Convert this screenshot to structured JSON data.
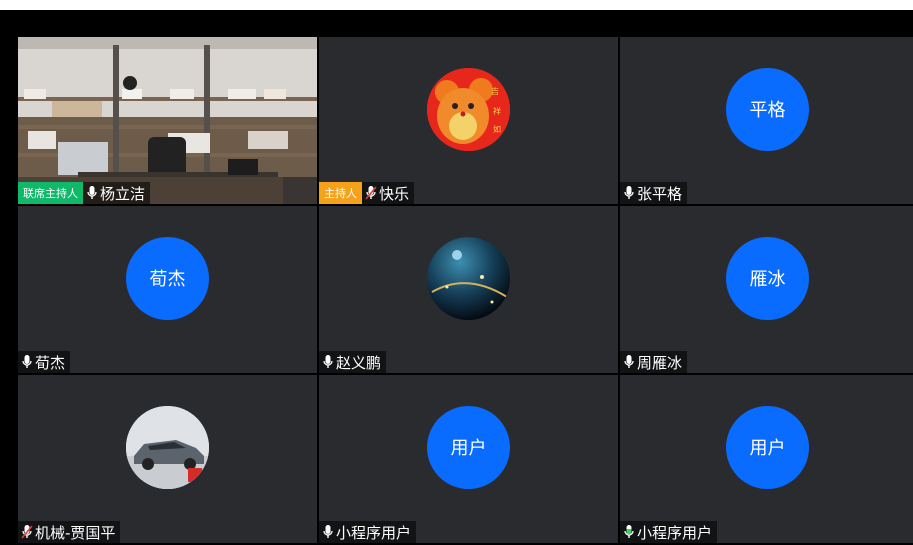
{
  "tiles": [
    {
      "key": "t1",
      "avatar_text": "",
      "avatar_kind": "office-video",
      "badge": "联席主持人",
      "badge_color": "#10b86a",
      "mic": "on",
      "name": "杨立洁"
    },
    {
      "key": "t2",
      "avatar_text": "",
      "avatar_kind": "cartoon-mouse-image",
      "badge": "主持人",
      "badge_color": "#f5a21a",
      "mic": "muted",
      "name": "快乐"
    },
    {
      "key": "t3",
      "avatar_text": "平格",
      "avatar_kind": "initials",
      "badge": "",
      "mic": "on",
      "name": "张平格"
    },
    {
      "key": "t4",
      "avatar_text": "荀杰",
      "avatar_kind": "initials",
      "badge": "",
      "mic": "on",
      "name": "荀杰"
    },
    {
      "key": "t5",
      "avatar_text": "",
      "avatar_kind": "space-image",
      "badge": "",
      "mic": "on",
      "name": "赵义鹏"
    },
    {
      "key": "t6",
      "avatar_text": "雁冰",
      "avatar_kind": "initials",
      "badge": "",
      "mic": "on",
      "name": "周雁冰"
    },
    {
      "key": "t7",
      "avatar_text": "",
      "avatar_kind": "car-image",
      "badge": "",
      "mic": "muted",
      "name": "机械-贾国平"
    },
    {
      "key": "t8",
      "avatar_text": "用户",
      "avatar_kind": "initials",
      "badge": "",
      "mic": "on",
      "name": "小程序用户"
    },
    {
      "key": "t9",
      "avatar_text": "用户",
      "avatar_kind": "initials",
      "badge": "",
      "mic": "speaking",
      "name": "小程序用户"
    }
  ],
  "colors": {
    "avatar_blue": "#0a6cff",
    "tile_bg": "#292b2f",
    "speaking_mic": "#3dd65a",
    "muted_mic": "#e23b3b"
  }
}
